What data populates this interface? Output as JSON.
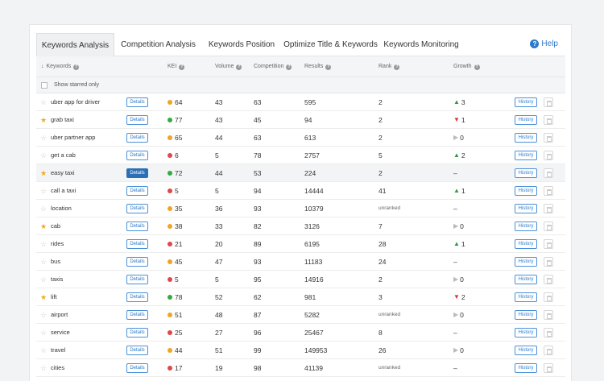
{
  "tabs": [
    {
      "label": "Keywords Analysis"
    },
    {
      "label": "Competition Analysis"
    },
    {
      "label": "Keywords Position"
    },
    {
      "label": "Optimize Title & Keywords"
    },
    {
      "label": "Keywords Monitoring"
    }
  ],
  "help_label": "Help",
  "columns": {
    "keywords": "Keywords",
    "kei": "KEI",
    "volume": "Volume",
    "competition": "Competition",
    "results": "Results",
    "rank": "Rank",
    "growth": "Growth"
  },
  "show_starred_label": "Show starred only",
  "details_label": "Details",
  "history_label": "History",
  "colors": {
    "kei_orange": "#f0a426",
    "kei_green": "#36a940",
    "kei_red": "#e0474c",
    "accent": "#2d7ac9"
  },
  "rows": [
    {
      "keyword": "uber app for driver",
      "starred": false,
      "kei": "64",
      "kei_color": "orange",
      "volume": "43",
      "competition": "63",
      "results": "595",
      "rank": "2",
      "growth": "3",
      "growth_dir": "up"
    },
    {
      "keyword": "grab taxi",
      "starred": true,
      "kei": "77",
      "kei_color": "green",
      "volume": "43",
      "competition": "45",
      "results": "94",
      "rank": "2",
      "growth": "1",
      "growth_dir": "down"
    },
    {
      "keyword": "uber partner app",
      "starred": false,
      "kei": "65",
      "kei_color": "orange",
      "volume": "44",
      "competition": "63",
      "results": "613",
      "rank": "2",
      "growth": "0",
      "growth_dir": "flat"
    },
    {
      "keyword": "get a cab",
      "starred": false,
      "kei": "6",
      "kei_color": "red",
      "volume": "5",
      "competition": "78",
      "results": "2757",
      "rank": "5",
      "growth": "2",
      "growth_dir": "up"
    },
    {
      "keyword": "easy taxi",
      "starred": true,
      "kei": "72",
      "kei_color": "green",
      "volume": "44",
      "competition": "53",
      "results": "224",
      "rank": "2",
      "growth": "–",
      "growth_dir": "none",
      "highlight": true
    },
    {
      "keyword": "call a taxi",
      "starred": false,
      "kei": "5",
      "kei_color": "red",
      "volume": "5",
      "competition": "94",
      "results": "14444",
      "rank": "41",
      "growth": "1",
      "growth_dir": "up"
    },
    {
      "keyword": "location",
      "starred": false,
      "kei": "35",
      "kei_color": "orange",
      "volume": "36",
      "competition": "93",
      "results": "10379",
      "rank": "unranked",
      "growth": "–",
      "growth_dir": "none"
    },
    {
      "keyword": "cab",
      "starred": true,
      "kei": "38",
      "kei_color": "orange",
      "volume": "33",
      "competition": "82",
      "results": "3126",
      "rank": "7",
      "growth": "0",
      "growth_dir": "flat"
    },
    {
      "keyword": "rides",
      "starred": false,
      "kei": "21",
      "kei_color": "red",
      "volume": "20",
      "competition": "89",
      "results": "6195",
      "rank": "28",
      "growth": "1",
      "growth_dir": "up"
    },
    {
      "keyword": "bus",
      "starred": false,
      "kei": "45",
      "kei_color": "orange",
      "volume": "47",
      "competition": "93",
      "results": "11183",
      "rank": "24",
      "growth": "–",
      "growth_dir": "none"
    },
    {
      "keyword": "taxis",
      "starred": false,
      "kei": "5",
      "kei_color": "red",
      "volume": "5",
      "competition": "95",
      "results": "14916",
      "rank": "2",
      "growth": "0",
      "growth_dir": "flat"
    },
    {
      "keyword": "lift",
      "starred": true,
      "kei": "78",
      "kei_color": "green",
      "volume": "52",
      "competition": "62",
      "results": "981",
      "rank": "3",
      "growth": "2",
      "growth_dir": "down"
    },
    {
      "keyword": "airport",
      "starred": false,
      "kei": "51",
      "kei_color": "orange",
      "volume": "48",
      "competition": "87",
      "results": "5282",
      "rank": "unranked",
      "growth": "0",
      "growth_dir": "flat"
    },
    {
      "keyword": "service",
      "starred": false,
      "kei": "25",
      "kei_color": "red",
      "volume": "27",
      "competition": "96",
      "results": "25467",
      "rank": "8",
      "growth": "–",
      "growth_dir": "none"
    },
    {
      "keyword": "travel",
      "starred": false,
      "kei": "44",
      "kei_color": "orange",
      "volume": "51",
      "competition": "99",
      "results": "149953",
      "rank": "26",
      "growth": "0",
      "growth_dir": "flat"
    },
    {
      "keyword": "cities",
      "starred": false,
      "kei": "17",
      "kei_color": "red",
      "volume": "19",
      "competition": "98",
      "results": "41139",
      "rank": "unranked",
      "growth": "–",
      "growth_dir": "none"
    }
  ]
}
